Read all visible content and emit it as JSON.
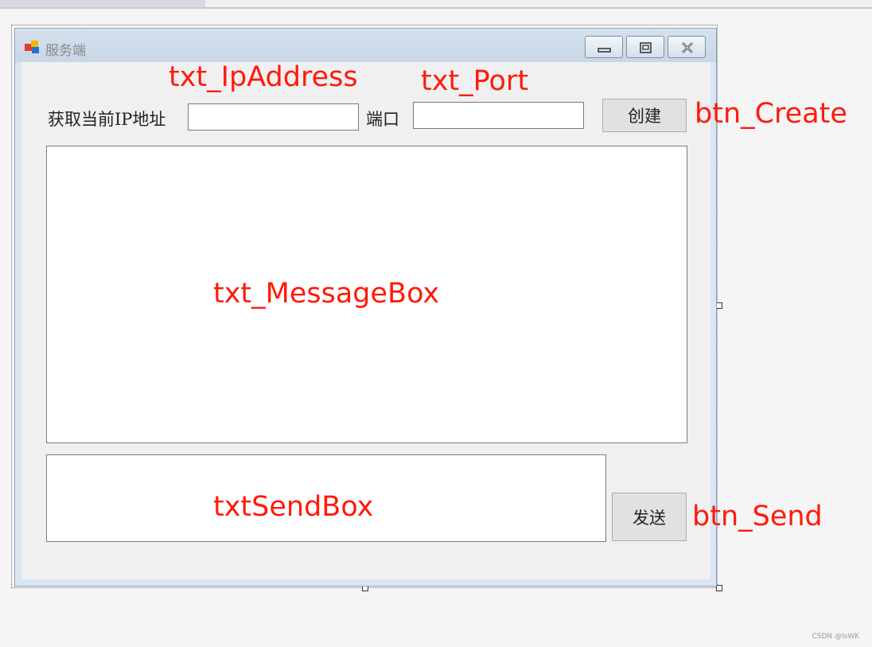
{
  "window": {
    "title": "服务端",
    "icon": "winforms-app-icon"
  },
  "form": {
    "ip_label": "获取当前IP地址",
    "ip_value": "",
    "port_label": "端口",
    "port_value": "",
    "create_button": "创建",
    "message_box_value": "",
    "send_box_value": "",
    "send_button": "发送"
  },
  "annotations": {
    "ip": "txt_IpAddress",
    "port": "txt_Port",
    "create": "btn_Create",
    "message": "txt_MessageBox",
    "send_box": "txtSendBox",
    "send": "btn_Send"
  },
  "watermark": "CSDN @lsWK",
  "colors": {
    "annotation": "#ff1a0a",
    "titlebar": "#c8d6e6",
    "client": "#f0f0f0"
  }
}
